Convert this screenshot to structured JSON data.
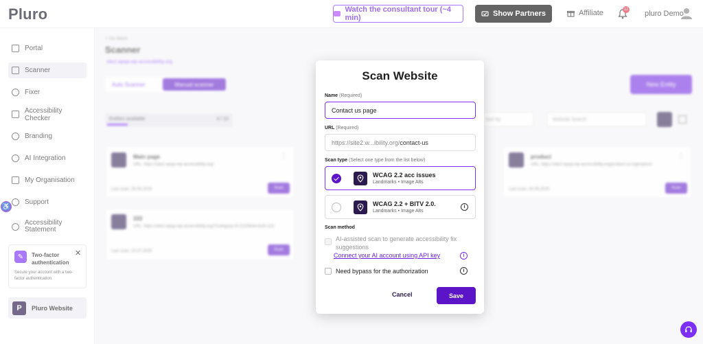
{
  "header": {
    "logo": "Pluro",
    "tour_label": "Watch the consultant tour (~4 min)",
    "partners_label": "Show Partners",
    "affiliate_label": "Affiliate",
    "notification_count": "12",
    "user_name": "pluro Demo"
  },
  "sidebar": {
    "items": [
      {
        "label": "Portal"
      },
      {
        "label": "Scanner"
      },
      {
        "label": "Fixer"
      },
      {
        "label": "Accessibility Checker"
      },
      {
        "label": "Branding"
      },
      {
        "label": "AI Integration"
      },
      {
        "label": "My Organisation"
      },
      {
        "label": "Support"
      },
      {
        "label": "Accessibility Statement"
      }
    ],
    "two_factor": {
      "title": "Two-factor authentication",
      "description": "Secure your account with a two-factor authentication."
    },
    "site_card": {
      "badge": "P",
      "label": "Pluro Website"
    }
  },
  "background": {
    "back_label": "< Go Back",
    "page_title": "Scanner",
    "site_url": "site2.wpqa-wp-accessibility.org",
    "tab_auto": "Auto Scanner",
    "tab_manual": "Manual scanner",
    "new_entity": "New Entity",
    "entities_label": "Entities available",
    "entities_count": "4 / 10",
    "sort_placeholder": "Sort by",
    "search_placeholder": "Website Search",
    "cards": [
      {
        "name": "Main page",
        "url": "URL: https://site2.wpqa-wp-accessibility.org/",
        "last": "Last scan: 26.06.2025",
        "scan": "Scan"
      },
      {
        "name": "product",
        "url": "URL: https://site2.wpqa-wp-accessibility.org/product-us-login/plorm",
        "last": "Last scan: 26.06.2025",
        "scan": "Scan"
      },
      {
        "name": "333",
        "url": "URL: https://site2.wpqa-wp-accessibility.org/?Category=3+2223644+6v6+113",
        "last": "Last scan: 23.07.2025",
        "scan": "Scan"
      }
    ]
  },
  "modal": {
    "title": "Scan Website",
    "name_label": "Name",
    "name_req": "(Required)",
    "name_value": "Contact us page",
    "url_label": "URL",
    "url_req": "(Required)",
    "url_prefix": "https://site2.w...ibility.org/",
    "url_path": "contact-us",
    "scan_type_label": "Scan type",
    "scan_type_hint": "(Select one type from the list below)",
    "types": [
      {
        "name": "WCAG 2.2 acc issues",
        "sub": "Landmarks  •  Image Alts",
        "selected": true
      },
      {
        "name": "WCAG 2.2 + BITV 2.0.",
        "sub": "Landmarks  •  Image Alts",
        "selected": false
      }
    ],
    "scan_method_label": "Scan method",
    "ai_option": "AI-assisted scan to generate accessibility fix suggestions",
    "api_link": "Connect your AI account using API key",
    "bypass_option": "Need bypass for the authorization",
    "cancel_label": "Cancel",
    "save_label": "Save"
  },
  "colors": {
    "accent": "#6a1fe0",
    "dark": "#2a1a4e",
    "badge": "#e8334a"
  }
}
